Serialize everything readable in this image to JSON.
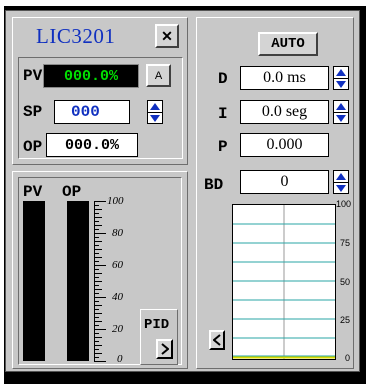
{
  "controller": {
    "tag": "LIC3201",
    "close_label": "✕",
    "pv_label": "PV",
    "pv_value": "000.0%",
    "mode_button_label": "A",
    "sp_label": "SP",
    "sp_value": "000",
    "op_label": "OP",
    "op_value": "000.0%"
  },
  "bargraph": {
    "pv_label": "PV",
    "op_label": "OP",
    "scale": [
      "100",
      "80",
      "60",
      "40",
      "20",
      "0"
    ],
    "pv_fill_percent": 0,
    "op_fill_percent": 0,
    "pid_label": "PID",
    "pid_nav_icon": "chevron-right-icon"
  },
  "tuning": {
    "auto_label": "AUTO",
    "d_label": "D",
    "d_value": "0.0 ms",
    "i_label": "I",
    "i_value": "0.0 seg",
    "p_label": "P",
    "p_value": "0.000",
    "bd_label": "BD",
    "bd_value": "0"
  },
  "trend": {
    "scale": [
      "100",
      "75",
      "50",
      "25",
      "0"
    ],
    "back_icon": "chevron-left-icon",
    "line_color": "#2aa6a6",
    "signal_color": "#d8d800"
  },
  "colors": {
    "tag_color": "#1030c0",
    "pv_value_bg": "#000000",
    "pv_value_fg": "#00e000",
    "sp_value_fg": "#1030c0",
    "bar_color": "#000000",
    "spin_arrow": "#1030c0"
  }
}
